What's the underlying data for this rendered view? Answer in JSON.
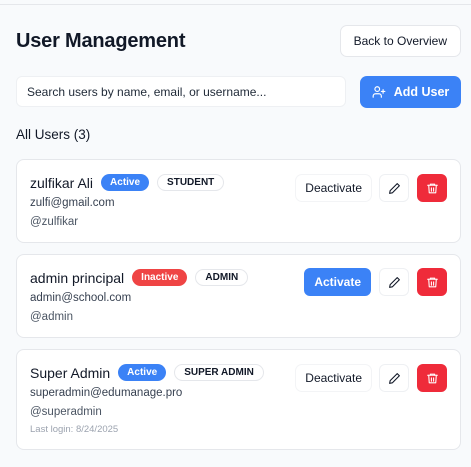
{
  "header": {
    "title": "User Management",
    "back_label": "Back to Overview"
  },
  "search": {
    "placeholder": "Search users by name, email, or username...",
    "value": ""
  },
  "add_user": {
    "label": "Add User",
    "icon": "user-plus-icon"
  },
  "section": {
    "title": "All Users (3)"
  },
  "colors": {
    "primary": "#3b82f6",
    "danger": "#ef4444",
    "background": "#f8fafc"
  },
  "users": [
    {
      "name": "zulfikar Ali",
      "status": "Active",
      "role": "STUDENT",
      "email": "zulfi@gmail.com",
      "username": "@zulfikar",
      "action_label": "Deactivate"
    },
    {
      "name": "admin principal",
      "status": "Inactive",
      "role": "ADMIN",
      "email": "admin@school.com",
      "username": "@admin",
      "action_label": "Activate"
    },
    {
      "name": "Super Admin",
      "status": "Active",
      "role": "SUPER ADMIN",
      "email": "superadmin@edumanage.pro",
      "username": "@superadmin",
      "last_login": "Last login: 8/24/2025",
      "action_label": "Deactivate"
    }
  ]
}
